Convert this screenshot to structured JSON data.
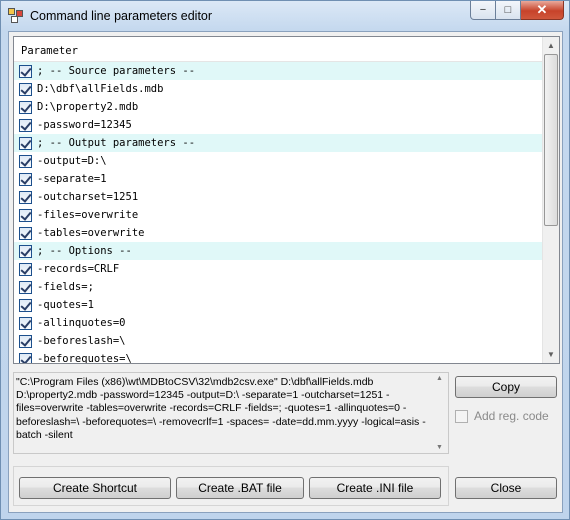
{
  "window": {
    "title": "Command line parameters editor",
    "buttons": {
      "minimize": "−",
      "maximize": "□",
      "close": "✕"
    }
  },
  "list": {
    "header": "Parameter",
    "rows": [
      {
        "text": "; -- Source parameters --",
        "section": true,
        "checked": true
      },
      {
        "text": "D:\\dbf\\allFields.mdb",
        "section": false,
        "checked": true
      },
      {
        "text": "D:\\property2.mdb",
        "section": false,
        "checked": true
      },
      {
        "text": "-password=12345",
        "section": false,
        "checked": true
      },
      {
        "text": "; -- Output parameters --",
        "section": true,
        "checked": true
      },
      {
        "text": "-output=D:\\",
        "section": false,
        "checked": true
      },
      {
        "text": "-separate=1",
        "section": false,
        "checked": true
      },
      {
        "text": "-outcharset=1251",
        "section": false,
        "checked": true
      },
      {
        "text": "-files=overwrite",
        "section": false,
        "checked": true
      },
      {
        "text": "-tables=overwrite",
        "section": false,
        "checked": true
      },
      {
        "text": "; -- Options --",
        "section": true,
        "checked": true
      },
      {
        "text": "-records=CRLF",
        "section": false,
        "checked": true
      },
      {
        "text": "-fields=;",
        "section": false,
        "checked": true
      },
      {
        "text": "-quotes=1",
        "section": false,
        "checked": true
      },
      {
        "text": "-allinquotes=0",
        "section": false,
        "checked": true
      },
      {
        "text": "-beforeslash=\\",
        "section": false,
        "checked": true
      },
      {
        "text": "-beforequotes=\\",
        "section": false,
        "checked": true
      }
    ]
  },
  "command_text": "\"C:\\Program Files (x86)\\wt\\MDBtoCSV\\32\\mdb2csv.exe\" D:\\dbf\\allFields.mdb D:\\property2.mdb -password=12345 -output=D:\\ -separate=1 -outcharset=1251 -files=overwrite -tables=overwrite -records=CRLF -fields=; -quotes=1 -allinquotes=0 -beforeslash=\\ -beforequotes=\\ -removecrlf=1 -spaces= -date=dd.mm.yyyy -logical=asis -batch -silent",
  "buttons": {
    "copy": "Copy",
    "add_reg_code": "Add reg. code",
    "create_shortcut": "Create Shortcut",
    "create_bat": "Create .BAT file",
    "create_ini": "Create .INI file",
    "close": "Close"
  },
  "icons": {
    "app": "app-icon",
    "scroll_up": "▲",
    "scroll_down": "▼"
  }
}
